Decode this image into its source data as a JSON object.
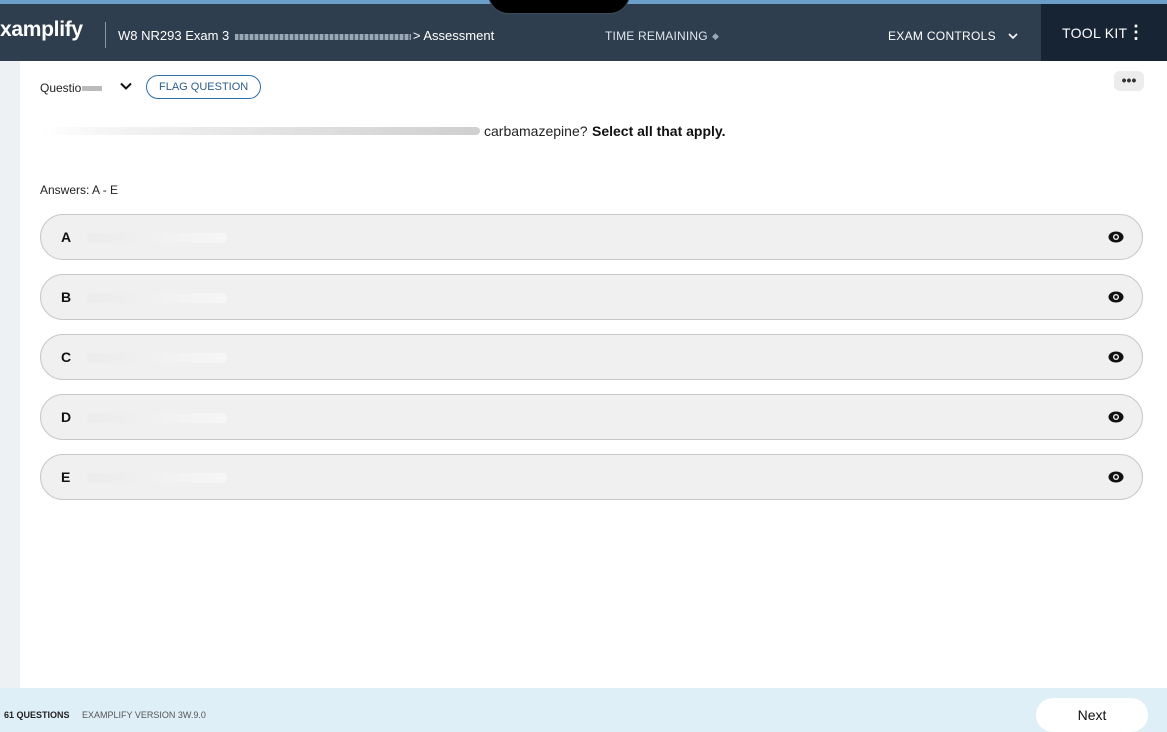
{
  "header": {
    "brand": "xamplify",
    "exam_title_prefix": "W8 NR293 Exam 3",
    "exam_title_suffix": "> Assessment",
    "time_remaining_label": "TIME REMAINING",
    "exam_controls_label": "EXAM CONTROLS",
    "tool_kit_label": "TOOL KIT"
  },
  "question": {
    "label": "Questio",
    "flag_label": "FLAG QUESTION",
    "more_label": "•••",
    "stem_visible": "carbamazepine?",
    "stem_bold": "Select all that apply.",
    "answers_label": "Answers: A - E"
  },
  "options": [
    {
      "letter": "A"
    },
    {
      "letter": "B"
    },
    {
      "letter": "C"
    },
    {
      "letter": "D"
    },
    {
      "letter": "E"
    }
  ],
  "footer": {
    "question_count": "61 QUESTIONS",
    "version": "EXAMPLIFY VERSION 3W.9.0",
    "next_label": "Next"
  },
  "colors": {
    "header_bg": "#2f3e4e",
    "toolkit_bg": "#162434",
    "footer_bg": "#dfeff7",
    "flag_border": "#2d6ea8"
  },
  "icons": {
    "more": "ellipsis-icon",
    "option_reveal": "eye-icon",
    "dropdown": "chevron-down-icon",
    "toolkit": "vertical-dots-icon"
  }
}
